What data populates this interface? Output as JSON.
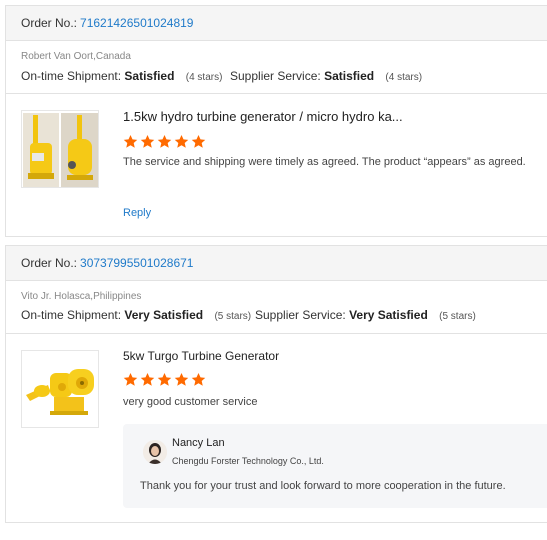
{
  "reviews": [
    {
      "order_label": "Order No.:",
      "order_number": "71621426501024819",
      "buyer": "Robert Van Oort,Canada",
      "shipment_label": "On-time Shipment:",
      "shipment_value": "Satisfied",
      "shipment_stars": "(4 stars)",
      "supplier_label": "Supplier Service:",
      "supplier_value": "Satisfied",
      "supplier_stars": "(4 stars)",
      "product_title": "1.5kw hydro turbine generator / micro hydro ka...",
      "rating": 5,
      "review_text": "The service and shipping were timely as agreed. The product “appears” as agreed.",
      "reply_label": "Reply"
    },
    {
      "order_label": "Order No.:",
      "order_number": "30737995501028671",
      "buyer": "Vito Jr. Holasca,Philippines",
      "shipment_label": "On-time Shipment:",
      "shipment_value": "Very Satisfied",
      "shipment_stars": "(5 stars)",
      "supplier_label": "Supplier Service:",
      "supplier_value": "Very Satisfied",
      "supplier_stars": "(5 stars)",
      "product_title": "5kw Turgo  Turbine Generator",
      "rating": 5,
      "review_text": "very good customer service",
      "supplier_reply": {
        "name": "Nancy Lan",
        "company": "Chengdu Forster Technology Co., Ltd.",
        "text": "Thank you for your trust and look forward to more cooperation in the future."
      }
    }
  ],
  "colors": {
    "link": "#1f7ac9",
    "star": "#ff6a00",
    "header_bg": "#f5f5f5",
    "reply_bg": "#f5f6f8"
  }
}
